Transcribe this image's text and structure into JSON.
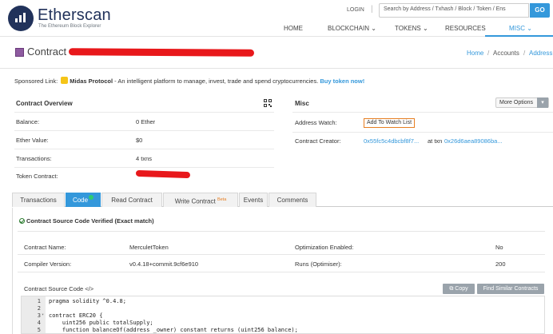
{
  "header": {
    "logo_title": "Etherscan",
    "logo_subtitle": "The Ethereum Block Explorer",
    "login": "LOGIN",
    "login_divider": "|",
    "search_placeholder": "Search by Address / Txhash / Block / Token / Ens",
    "go_label": "GO",
    "nav": [
      {
        "label": "HOME",
        "caret": ""
      },
      {
        "label": "BLOCKCHAIN",
        "caret": "⌄"
      },
      {
        "label": "TOKENS",
        "caret": "⌄"
      },
      {
        "label": "RESOURCES",
        "caret": ""
      },
      {
        "label": "MISC",
        "caret": "⌄"
      }
    ],
    "accent_color": "#3498db"
  },
  "title": {
    "text": "Contract",
    "breadcrumb": [
      "Home",
      "Accounts",
      "Address"
    ],
    "breadcrumb_sep": "/"
  },
  "sponsor": {
    "prefix": "Sponsored Link:",
    "brand": "Midas Protocol",
    "text": " - An intelligent platform to manage, invest, trade and spend cryptocurrencies.",
    "cta": "Buy token now!"
  },
  "overview": {
    "heading": "Contract Overview",
    "rows": [
      {
        "label": "Balance:",
        "value": "0 Ether"
      },
      {
        "label": "Ether Value:",
        "value": "$0"
      },
      {
        "label": "Transactions:",
        "value": "4 txns"
      },
      {
        "label": "Token Contract:",
        "value": ""
      }
    ]
  },
  "misc": {
    "heading": "Misc",
    "more_options": "More Options",
    "more_caret": "▾",
    "address_watch_label": "Address Watch:",
    "address_watch_button": "Add To Watch List",
    "creator_label": "Contract Creator:",
    "creator_address": "0x55fc5c4dbcbf8f7...",
    "creator_at": "at txn",
    "creator_txn": "0x26d6aea89086ba..."
  },
  "tabs": [
    {
      "label": "Transactions",
      "sup": ""
    },
    {
      "label": "Code",
      "sup": ""
    },
    {
      "label": "Read Contract",
      "sup": ""
    },
    {
      "label": "Write Contract",
      "sup": "Beta"
    },
    {
      "label": "Events",
      "sup": ""
    },
    {
      "label": "Comments",
      "sup": ""
    }
  ],
  "code": {
    "verified_text": "Contract Source Code Verified (Exact match)",
    "contract_name_label": "Contract Name:",
    "contract_name": "MerculetToken",
    "compiler_label": "Compiler Version:",
    "compiler": "v0.4.18+commit.9cf6e910",
    "optimization_label": "Optimization Enabled:",
    "optimization": "No",
    "runs_label": "Runs (Optimiser):",
    "runs": "200",
    "source_label": "Contract Source Code </>",
    "copy_label": "Copy",
    "similar_label": "Find Similar Contracts",
    "lines": [
      {
        "n": "1",
        "fold": "",
        "text": "pragma solidity ^0.4.8;"
      },
      {
        "n": "2",
        "fold": "",
        "text": ""
      },
      {
        "n": "3",
        "fold": "▾",
        "text": "contract ERC20 {"
      },
      {
        "n": "4",
        "fold": "",
        "text": "    uint256 public totalSupply;"
      },
      {
        "n": "5",
        "fold": "",
        "text": "    function balanceOf(address _owner) constant returns (uint256 balance);"
      }
    ]
  }
}
